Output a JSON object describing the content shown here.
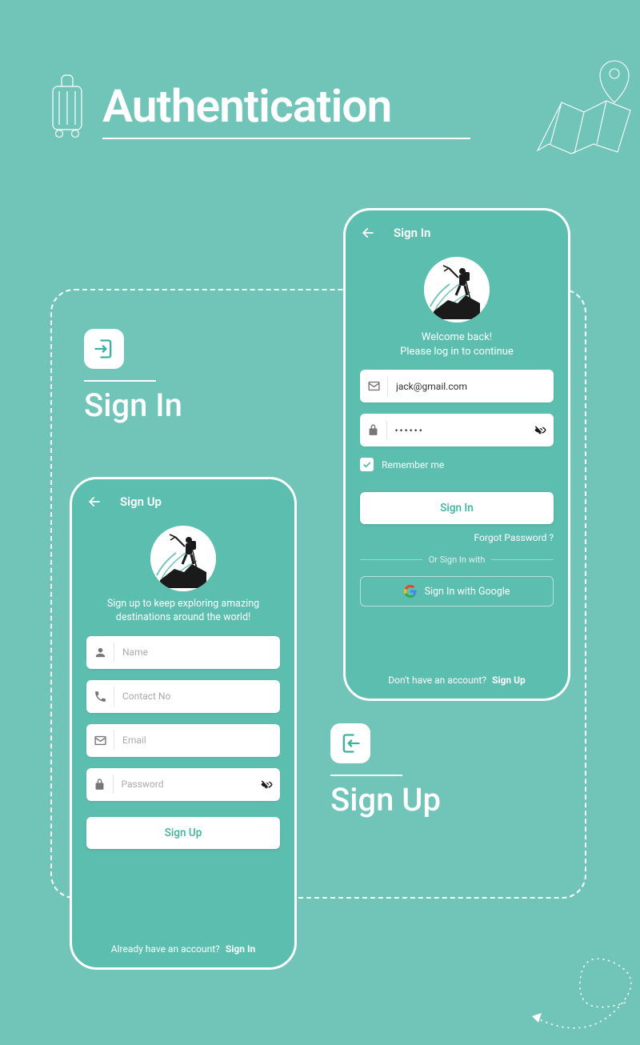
{
  "page_title": "Authentication",
  "labels": {
    "signin": "Sign In",
    "signup": "Sign Up"
  },
  "signin_screen": {
    "title": "Sign In",
    "welcome_line1": "Welcome back!",
    "welcome_line2": "Please log in to continue",
    "email_value": "jack@gmail.com",
    "password_value": "••••••",
    "remember_label": "Remember me",
    "button": "Sign In",
    "forgot": "Forgot Password ?",
    "or_text": "Or Sign In with",
    "google_button": "Sign In with Google",
    "bottom_prefix": "Don't have an account?",
    "bottom_action": "Sign Up"
  },
  "signup_screen": {
    "title": "Sign Up",
    "subtitle_line1": "Sign up to keep exploring amazing",
    "subtitle_line2": "destinations around the world!",
    "name_placeholder": "Name",
    "contact_placeholder": "Contact No",
    "email_placeholder": "Email",
    "password_placeholder": "Password",
    "button": "Sign Up",
    "bottom_prefix": "Already have an account?",
    "bottom_action": "Sign In"
  }
}
